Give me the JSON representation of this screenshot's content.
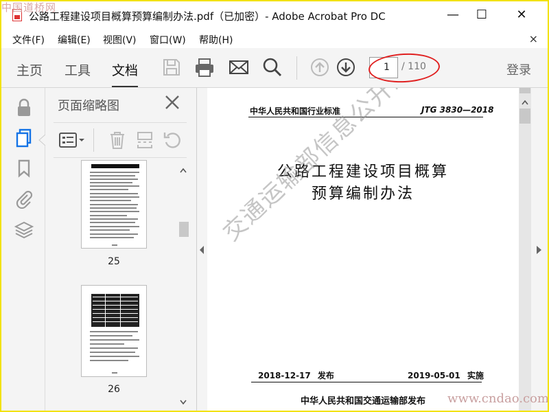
{
  "watermark_corner": "中国道桥网",
  "watermark_bottom": "www.cndao.com",
  "watermark_diagonal": "交通运输部信息公开浏览专用",
  "window": {
    "title": "公路工程建设项目概算预算编制办法.pdf（已加密）- Adobe Acrobat Pro DC",
    "minimize": "—",
    "maximize": "☐",
    "close": "✕"
  },
  "menu": {
    "items": [
      "文件(F)",
      "编辑(E)",
      "视图(V)",
      "窗口(W)",
      "帮助(H)"
    ],
    "close_doc": "×"
  },
  "toolbar": {
    "tabs": [
      "主页",
      "工具",
      "文档"
    ],
    "active_tab": "文档",
    "current_page": "1",
    "total_pages": "/ 110",
    "login": "登录"
  },
  "thumbnails_panel": {
    "title": "页面缩略图",
    "pages": [
      {
        "number": "25"
      },
      {
        "number": "26"
      }
    ]
  },
  "document": {
    "header_left": "中华人民共和国行业标准",
    "header_right": "JTG 3830—2018",
    "title_line1": "公路工程建设项目概算",
    "title_line2": "预算编制办法",
    "issue_date": "2018-12-17 发布",
    "effective_date": "2019-05-01 实施",
    "publisher": "中华人民共和国交通运输部发布"
  },
  "colors": {
    "accent_blue": "#1473e6",
    "frame_yellow": "#f2e200",
    "annotation_red": "#e02020"
  }
}
